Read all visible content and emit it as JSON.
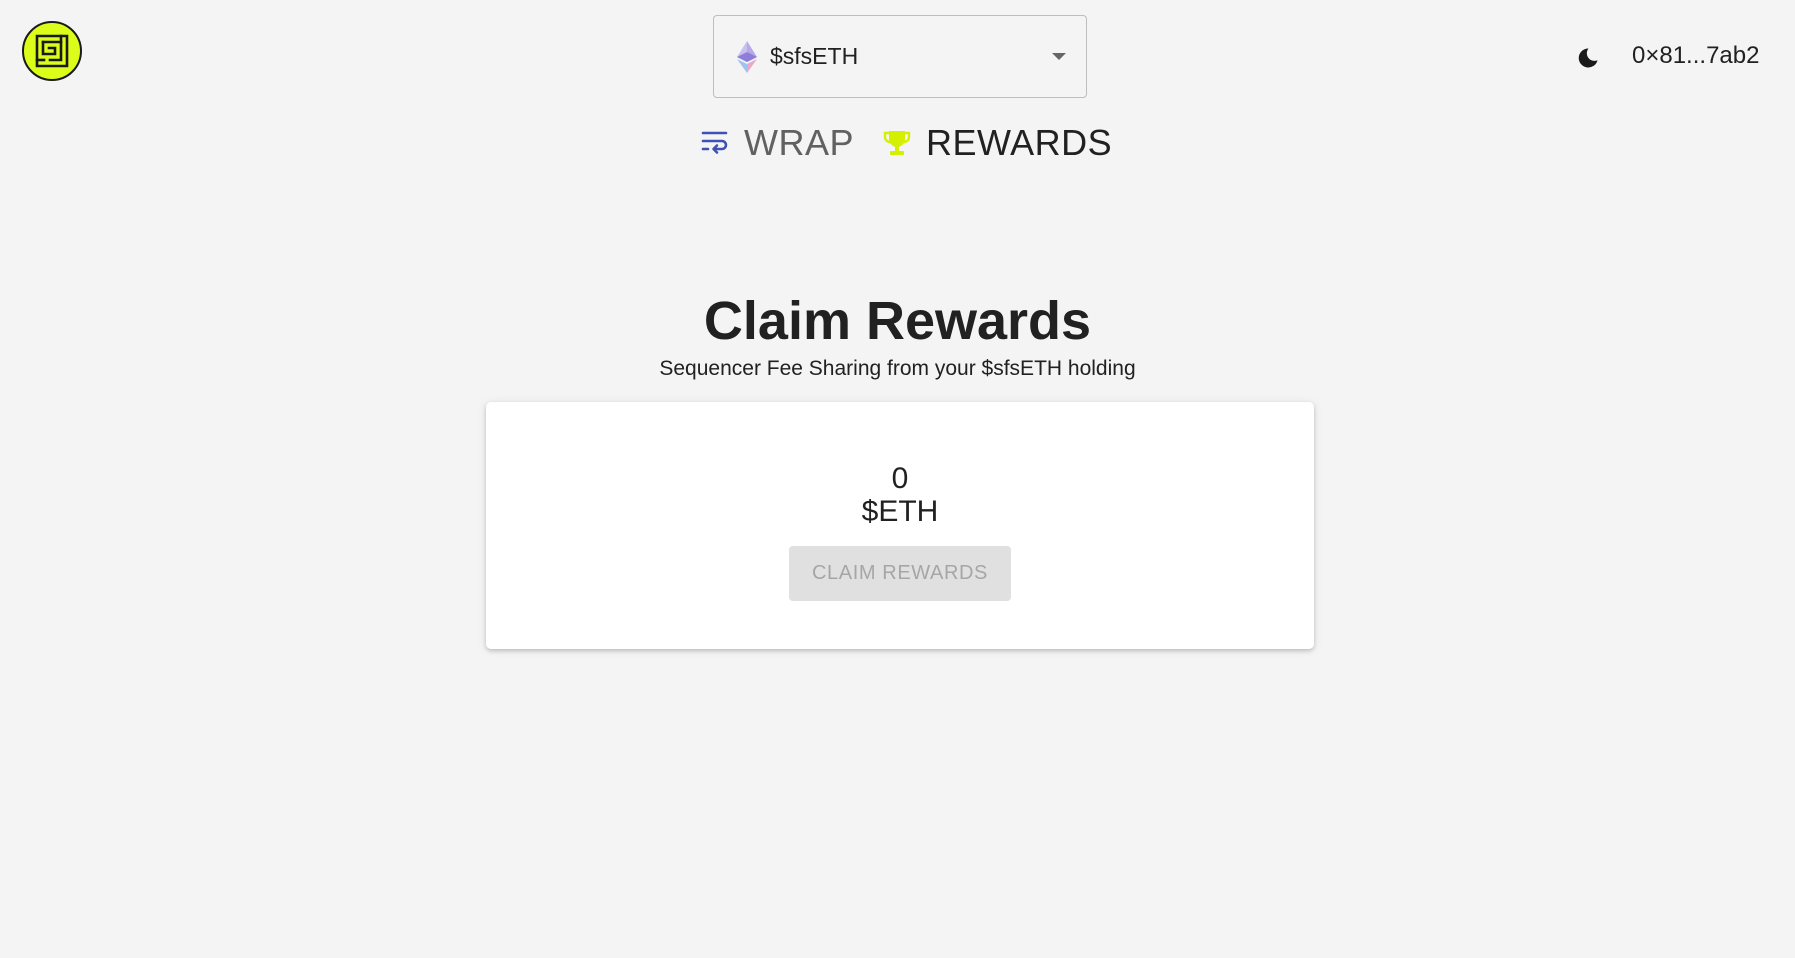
{
  "header": {
    "logo_icon": "maze-logo-icon",
    "token_select": {
      "icon": "ethereum-icon",
      "selected_value": "$sfsETH"
    },
    "theme_toggle_icon": "moon-icon",
    "wallet_address": "0×81...7ab2"
  },
  "nav": {
    "tabs": [
      {
        "label": "WRAP",
        "icon": "wrap-icon",
        "color": "#3f51b5"
      },
      {
        "label": "REWARDS",
        "icon": "trophy-icon",
        "color": "#d4f000"
      }
    ]
  },
  "main": {
    "title": "Claim Rewards",
    "subtitle": "Sequencer Fee Sharing from your $sfsETH holding",
    "card": {
      "amount": "0",
      "currency": "$ETH",
      "claim_label": "CLAIM REWARDS"
    }
  },
  "colors": {
    "accent": "#dcfc1a",
    "background": "#f4f4f4",
    "wrap_icon": "#3f51b5"
  }
}
